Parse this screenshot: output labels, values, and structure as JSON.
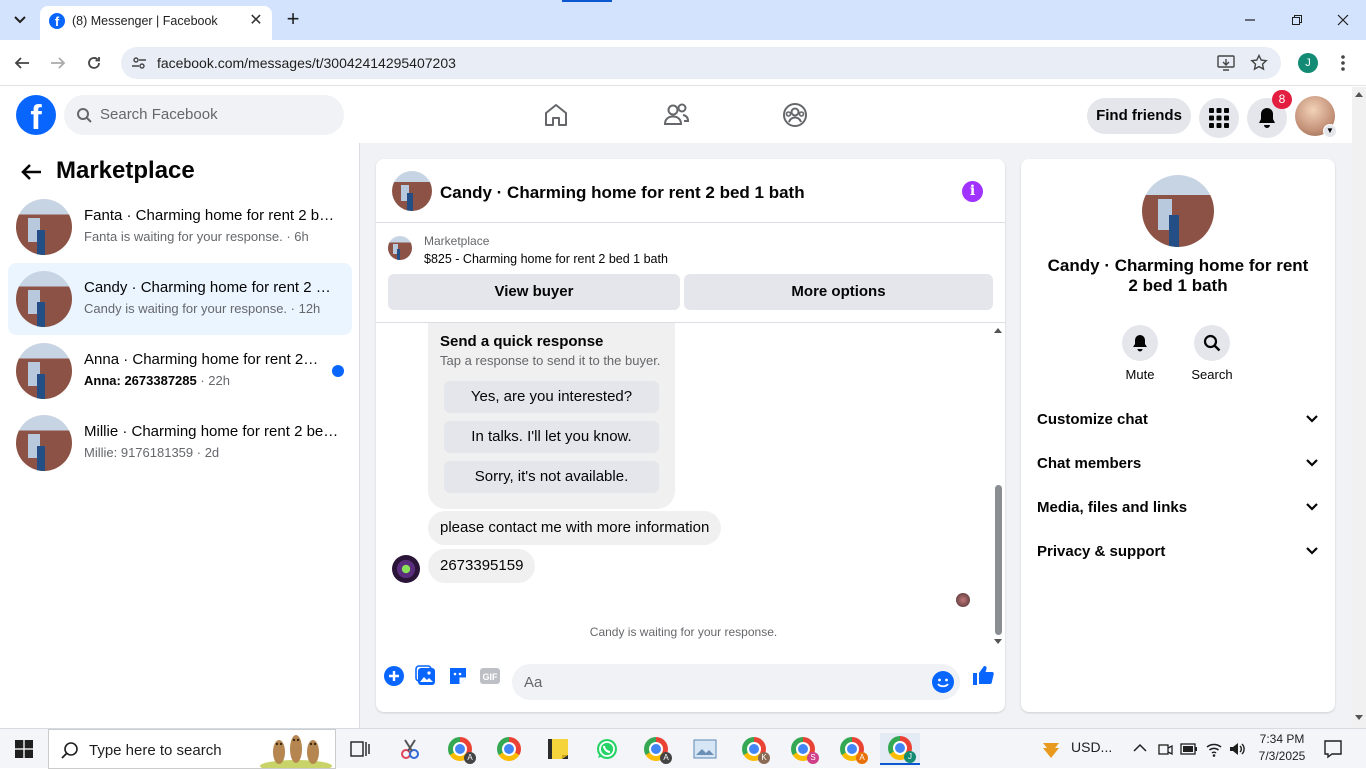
{
  "browser": {
    "tab_title": "(8) Messenger | Facebook",
    "url": "facebook.com/messages/t/30042414295407203",
    "profile_initial": "J"
  },
  "fb": {
    "search_placeholder": "Search Facebook",
    "find_friends": "Find friends",
    "notif_count": "8"
  },
  "left": {
    "title": "Marketplace",
    "conversations": [
      {
        "name": "Fanta · Charming home for rent 2 bed 1 bath",
        "sub": "Fanta is waiting for your response. · 6h",
        "unread": false,
        "selected": false
      },
      {
        "name": "Candy · Charming home for rent 2 bed 1 bath",
        "sub": "Candy is waiting for your response. · 12h",
        "unread": false,
        "selected": true
      },
      {
        "name": "Anna · Charming home for rent 2 bed 1 bath",
        "sub_bold": "Anna: 2673387285",
        "sub_time": " · 22h",
        "unread": true,
        "selected": false
      },
      {
        "name": "Millie · Charming home for rent 2 bed 1 bath",
        "sub": "Millie: 9176181359 · 2d",
        "unread": false,
        "selected": false
      }
    ]
  },
  "chat": {
    "title": "Candy · Charming home for rent 2 bed 1 bath",
    "listing_label": "Marketplace",
    "listing_price": "$825 - Charming home for rent 2 bed 1 bath",
    "view_buyer": "View buyer",
    "more_options": "More options",
    "quick_title": "Send a quick response",
    "quick_sub": "Tap a response to send it to the buyer.",
    "quick_options": [
      "Yes, are you interested?",
      "In talks. I'll let you know.",
      "Sorry, it's not available."
    ],
    "messages": [
      "please contact me with more information",
      "2673395159"
    ],
    "waiting": "Candy is waiting for your response.",
    "input_placeholder": "Aa"
  },
  "right": {
    "name": "Candy · Charming home for rent 2 bed 1 bath",
    "actions": [
      "Mute",
      "Search"
    ],
    "sections": [
      "Customize chat",
      "Chat members",
      "Media, files and links",
      "Privacy & support"
    ]
  },
  "taskbar": {
    "search_placeholder": "Type here to search",
    "tray_currency": "USD...",
    "time": "7:34 PM",
    "date": "7/3/2025",
    "chrome_badges": [
      "A",
      "A",
      "K",
      "S",
      "A",
      "J"
    ]
  },
  "colors": {
    "fb_blue": "#0866ff",
    "selected_bg": "#ebf5ff",
    "notif_red": "#e41e3f",
    "info_purple": "#a033ff"
  }
}
